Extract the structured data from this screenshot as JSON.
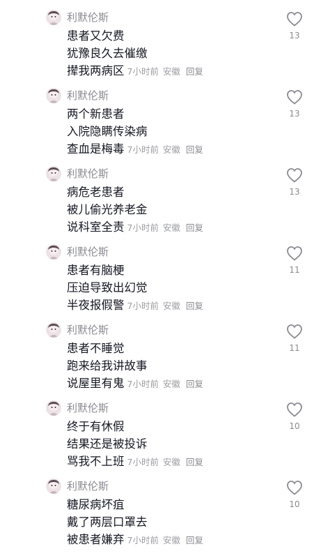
{
  "comments": [
    {
      "author": "利默伦斯",
      "lines": [
        "患者又欠费",
        "犹豫良久去催缴",
        "撵我两病区"
      ],
      "time": "7小时前",
      "location": "安徽",
      "reply": "回复",
      "likes": "13"
    },
    {
      "author": "利默伦斯",
      "lines": [
        "两个新患者",
        "入院隐瞒传染病",
        "查血是梅毒"
      ],
      "time": "7小时前",
      "location": "安徽",
      "reply": "回复",
      "likes": "13"
    },
    {
      "author": "利默伦斯",
      "lines": [
        "病危老患者",
        "被儿偷光养老金",
        "说科室全责"
      ],
      "time": "7小时前",
      "location": "安徽",
      "reply": "回复",
      "likes": "13"
    },
    {
      "author": "利默伦斯",
      "lines": [
        "患者有脑梗",
        "压迫导致出幻觉",
        "半夜报假警"
      ],
      "time": "7小时前",
      "location": "安徽",
      "reply": "回复",
      "likes": "11"
    },
    {
      "author": "利默伦斯",
      "lines": [
        "患者不睡觉",
        "跑来给我讲故事",
        "说屋里有鬼"
      ],
      "time": "7小时前",
      "location": "安徽",
      "reply": "回复",
      "likes": "11"
    },
    {
      "author": "利默伦斯",
      "lines": [
        "终于有休假",
        "结果还是被投诉",
        "骂我不上班"
      ],
      "time": "7小时前",
      "location": "安徽",
      "reply": "回复",
      "likes": "10"
    },
    {
      "author": "利默伦斯",
      "lines": [
        "糖尿病坏疽",
        "戴了两层口罩去",
        "被患者嫌弃"
      ],
      "time": "7小时前",
      "location": "安徽",
      "reply": "回复",
      "likes": "10"
    }
  ],
  "icons": {
    "avatar": "avatar-image",
    "like": "heart-outline-icon"
  },
  "colors": {
    "text": "#161823",
    "secondary": "#8a8b91",
    "background": "#ffffff"
  }
}
